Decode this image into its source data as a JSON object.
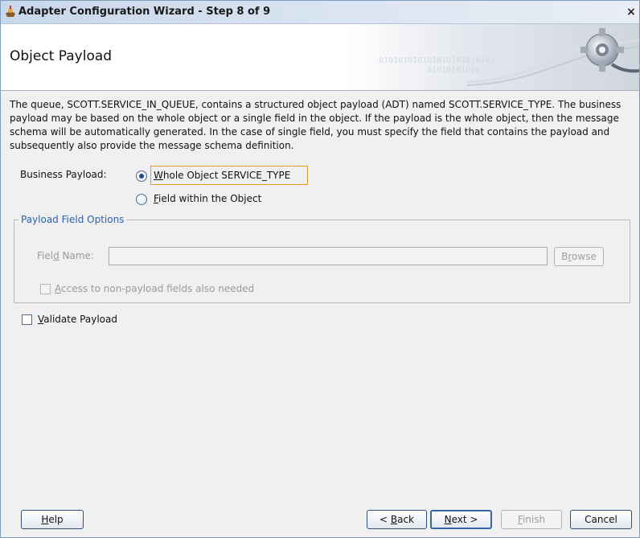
{
  "window": {
    "title": "Adapter Configuration Wizard - Step 8 of 9",
    "close_glyph": "×"
  },
  "header": {
    "title": "Object Payload",
    "binary_text_1": "010101010101010101010101",
    "binary_text_2": "01010101010"
  },
  "description": "The queue, SCOTT.SERVICE_IN_QUEUE, contains a structured object payload (ADT) named SCOTT.SERVICE_TYPE. The business payload may be based on the whole object or a single field in the object. If the payload is the whole object, then the message schema will be automatically generated. In the case of single field, you must specify the field that contains the payload and subsequently also provide the message schema definition.",
  "business_payload": {
    "label": "Business Payload:",
    "options": [
      {
        "mnemonic": "W",
        "rest": "hole Object SERVICE_TYPE",
        "selected": true
      },
      {
        "mnemonic": "F",
        "rest": "ield within the Object",
        "selected": false
      }
    ]
  },
  "payload_field_options": {
    "legend": "Payload Field Options",
    "field_label_pre": "Fiel",
    "field_label_mnemonic": "d",
    "field_label_post": " Name:",
    "field_value": "",
    "browse_pre": "B",
    "browse_mnemonic": "r",
    "browse_post": "owse",
    "access_mnemonic": "A",
    "access_rest": "ccess to non-payload fields also needed",
    "access_checked": false
  },
  "validate_payload": {
    "mnemonic": "V",
    "rest": "alidate Payload",
    "checked": false
  },
  "buttons": {
    "help_mnemonic": "H",
    "help_rest": "elp",
    "back_pre": "< ",
    "back_mnemonic": "B",
    "back_rest": "ack",
    "next_mnemonic": "N",
    "next_rest": "ext >",
    "finish_mnemonic": "F",
    "finish_rest": "inish",
    "cancel": "Cancel"
  },
  "colors": {
    "focus_outline": "#e59a2c",
    "legend_text": "#2d5fa8",
    "title_gradient_start": "#c8d7ea"
  },
  "icons": [
    "app-icon",
    "close-icon",
    "gear-cable-icon"
  ]
}
